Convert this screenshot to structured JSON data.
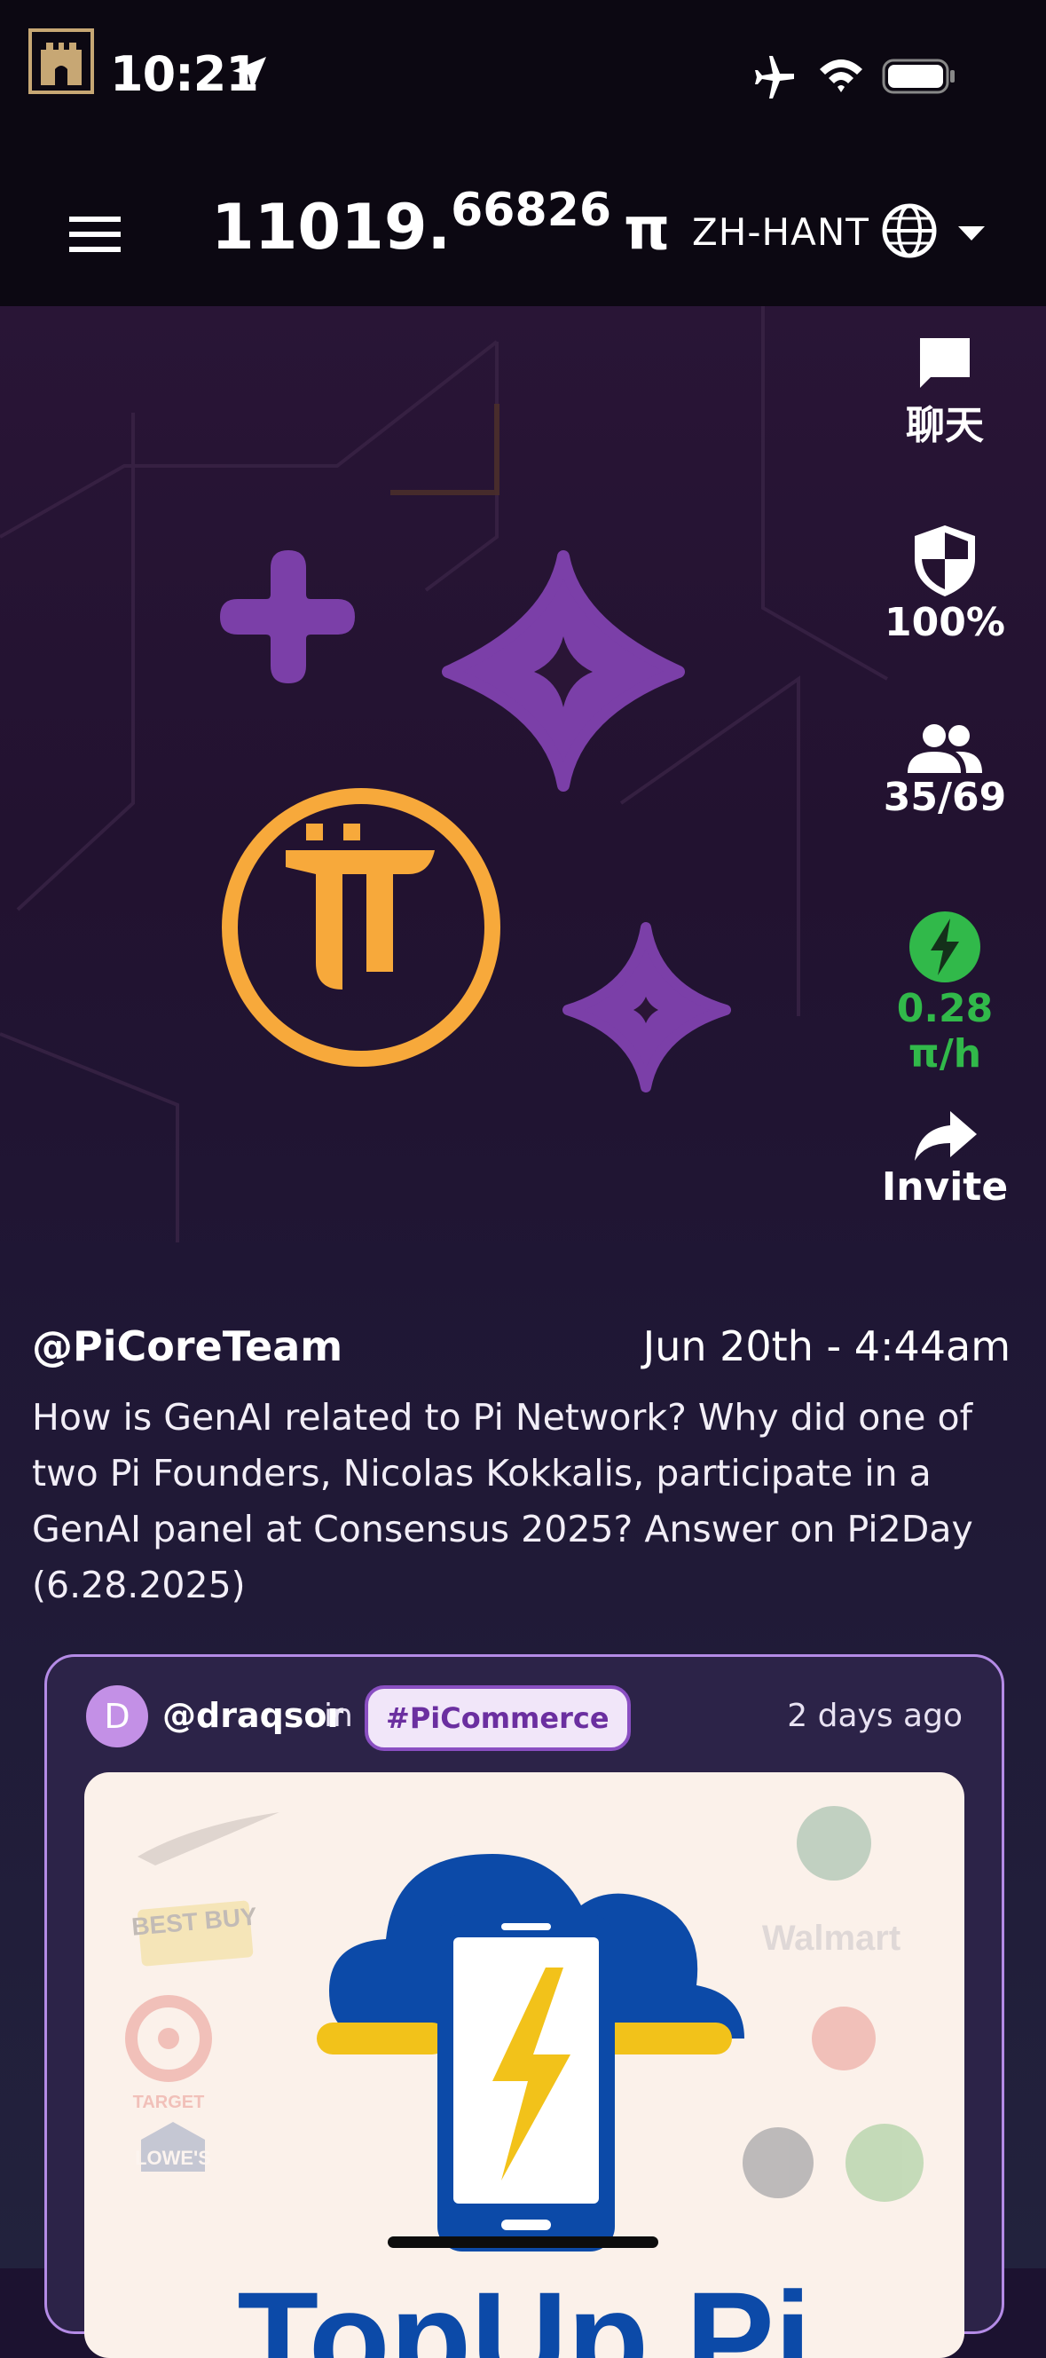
{
  "status_bar": {
    "time": "10:21"
  },
  "header": {
    "balance_int": "11019.",
    "balance_dec": "66826",
    "balance_unit": "π",
    "language": "ZH-HANT"
  },
  "side_menu": {
    "chat": "聊天",
    "security": "100%",
    "team": "35/69",
    "mining_rate": "0.28 π/h",
    "invite": "Invite"
  },
  "post": {
    "author": "@PiCoreTeam",
    "time": "Jun 20th - 4:44am",
    "body": "How is GenAI related to Pi Network? Why did one of two Pi Founders, Nicolas Kokkalis, participate in a GenAI panel at Consensus 2025? Answer on Pi2Day (6.28.2025)"
  },
  "card": {
    "avatar_letter": "D",
    "user": "@draqsor",
    "in": "in",
    "tag": "#PiCommerce",
    "ago": "2 days ago",
    "image_text": "TopUp Pi",
    "brand_logos": [
      "BEST BUY",
      "Walmart",
      "TARGET",
      "LOWE'S"
    ]
  },
  "colors": {
    "accent_purple": "#8a4fc2",
    "pi_gold": "#f7a93b",
    "mining_green": "#31b94a",
    "sparkle_purple": "#7b3fa8"
  }
}
